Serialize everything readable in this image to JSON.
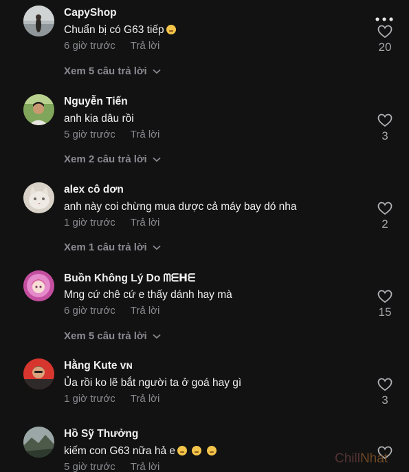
{
  "comments": [
    {
      "author": "CapyShop",
      "text": "Chuẩn bị có G63 tiếp",
      "time": "6 giờ trước",
      "reply_label": "Trả lời",
      "view_replies": "Xem 5 câu trả lời",
      "likes": "20",
      "avatar_icon": "avatar-woman-at-sea"
    },
    {
      "author": "Nguyễn Tiến",
      "text": "anh kia dâu rồi",
      "time": "5 giờ trước",
      "reply_label": "Trả lời",
      "view_replies": "Xem 2 câu trả lời",
      "likes": "3",
      "avatar_icon": "avatar-man-outdoors"
    },
    {
      "author": "alex cô dơn",
      "text": "anh này coi chừng mua dược cả máy bay dó nha",
      "time": "1 giờ trước",
      "reply_label": "Trả lời",
      "view_replies": "Xem 1 câu trả lời",
      "likes": "2",
      "avatar_icon": "avatar-cat"
    },
    {
      "author": "Buồn Không Lý Do ᗰᗴᕼᗴ",
      "text": "Mng cứ chê cứ e thấy dánh hay mà",
      "time": "6 giờ trước",
      "reply_label": "Trả lời",
      "view_replies": "Xem 5 câu trả lời",
      "likes": "15",
      "avatar_icon": "avatar-anime-girl"
    },
    {
      "author": "Hằng Kute ᴠɴ",
      "text": "Ủa rồi ko lẽ bắt người ta ở goá hay gì",
      "time": "1 giờ trước",
      "reply_label": "Trả lời",
      "likes": "3",
      "avatar_icon": "avatar-man-red"
    },
    {
      "author": "Hồ Sỹ Thưởng",
      "text": "kiếm con G63 nữa hả e",
      "time": "5 giờ trước",
      "reply_label": "Trả lời",
      "avatar_icon": "avatar-landscape"
    }
  ],
  "icons": {
    "more": "more-horizontal-icon",
    "like": "heart-outline-icon",
    "chevron": "chevron-down-icon"
  },
  "watermark": {
    "part1": "Chill",
    "part2": "Nhat"
  },
  "colors": {
    "background": "#121212",
    "text_primary": "#f1f1f2",
    "text_secondary": "#8a8b91"
  }
}
